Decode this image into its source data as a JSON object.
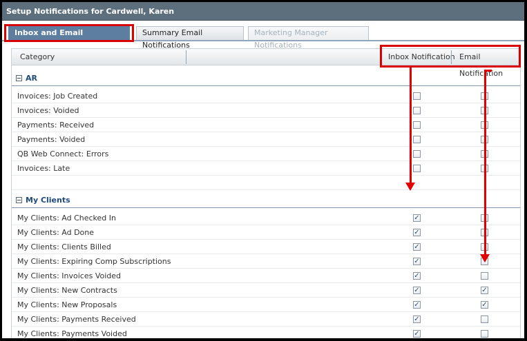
{
  "window": {
    "title": "Setup Notifications for Cardwell, Karen"
  },
  "tabs": [
    {
      "label": "Inbox and Email Notifications",
      "state": "active"
    },
    {
      "label": "Summary Email Notifications",
      "state": "normal"
    },
    {
      "label": "Marketing Manager Notifications",
      "state": "disabled"
    }
  ],
  "grid": {
    "columns": {
      "category": "Category",
      "inbox": "Inbox Notification",
      "email": "Email Notification"
    },
    "groups": [
      {
        "name": "AR",
        "rows": [
          {
            "label": "Invoices: Job Created",
            "inbox": false,
            "email": false
          },
          {
            "label": "Invoices: Voided",
            "inbox": false,
            "email": false
          },
          {
            "label": "Payments: Received",
            "inbox": false,
            "email": false
          },
          {
            "label": "Payments: Voided",
            "inbox": false,
            "email": false
          },
          {
            "label": "QB Web Connect: Errors",
            "inbox": false,
            "email": false
          },
          {
            "label": "Invoices: Late",
            "inbox": false,
            "email": false
          }
        ]
      },
      {
        "name": "My Clients",
        "rows": [
          {
            "label": "My Clients: Ad Checked In",
            "inbox": true,
            "email": false
          },
          {
            "label": "My Clients: Ad Done",
            "inbox": true,
            "email": false
          },
          {
            "label": "My Clients: Clients Billed",
            "inbox": true,
            "email": false
          },
          {
            "label": "My Clients: Expiring Comp Subscriptions",
            "inbox": true,
            "email": false
          },
          {
            "label": "My Clients: Invoices Voided",
            "inbox": true,
            "email": false
          },
          {
            "label": "My Clients: New Contracts",
            "inbox": true,
            "email": true
          },
          {
            "label": "My Clients: New Proposals",
            "inbox": true,
            "email": true
          },
          {
            "label": "My Clients: Payments Received",
            "inbox": true,
            "email": false
          },
          {
            "label": "My Clients: Payments Voided",
            "inbox": true,
            "email": false
          }
        ]
      }
    ]
  },
  "colors": {
    "annotation": "#e00000",
    "active_tab": "#5e7ea0",
    "titlebar": "#5d6e7d",
    "group_text": "#1e4a7c"
  }
}
